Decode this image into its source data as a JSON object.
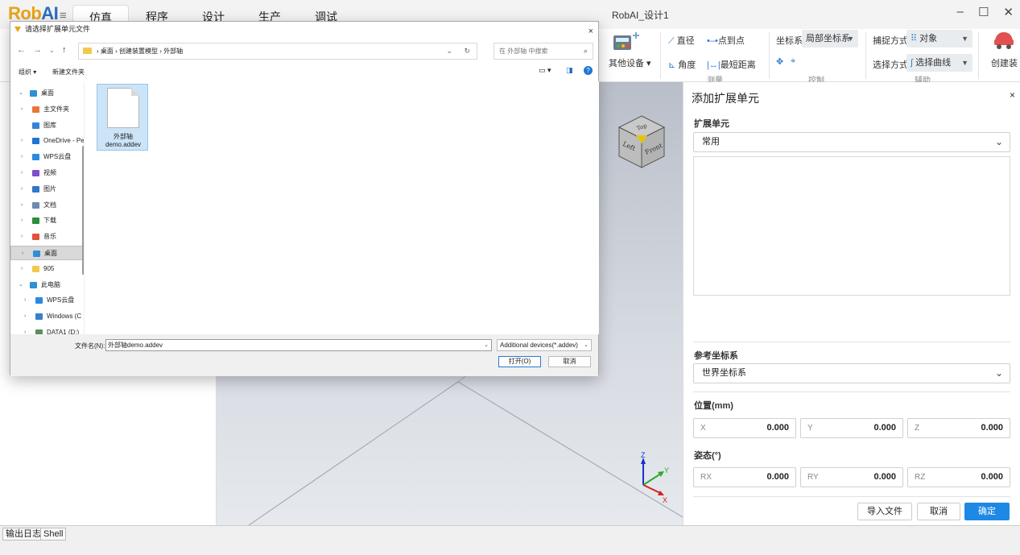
{
  "app": {
    "logo_rob": "Rob",
    "logo_ai": "AI",
    "window_title": "RobAI_设计1",
    "main_tabs": [
      "仿真",
      "程序",
      "设计",
      "生产",
      "调试"
    ]
  },
  "ribbon": {
    "other_devices": "其他设备",
    "diameter": "直径",
    "point_to_point": "点到点",
    "angle": "角度",
    "shortest_distance": "最短距离",
    "group_measure": "测量",
    "coord_label": "坐标系",
    "coord_value": "局部坐标系",
    "group_control": "控制",
    "snap_label": "捕捉方式",
    "snap_value": "对象",
    "select_label": "选择方式",
    "select_value": "选择曲线",
    "group_assist": "辅助",
    "create_label": "创建装"
  },
  "view_cube": {
    "top": "Top",
    "left": "Left",
    "front": "Front"
  },
  "axes": {
    "x": "X",
    "y": "Y",
    "z": "Z"
  },
  "panel": {
    "title": "添加扩展单元",
    "close": "×",
    "ext_unit_label": "扩展单元",
    "ext_unit_value": "常用",
    "ref_coord_label": "参考坐标系",
    "ref_coord_value": "世界坐标系",
    "position_label": "位置(mm)",
    "pose_label": "姿态(°)",
    "pos": [
      {
        "label": "X",
        "value": "0.000"
      },
      {
        "label": "Y",
        "value": "0.000"
      },
      {
        "label": "Z",
        "value": "0.000"
      }
    ],
    "rot": [
      {
        "label": "RX",
        "value": "0.000"
      },
      {
        "label": "RY",
        "value": "0.000"
      },
      {
        "label": "RZ",
        "value": "0.000"
      }
    ],
    "btn_import": "导入文件",
    "btn_cancel": "取消",
    "btn_ok": "确定"
  },
  "bottom_tabs": [
    "输出日志",
    "Shell"
  ],
  "dialog": {
    "title": "请选择扩展单元文件",
    "close": "×",
    "breadcrumb": "›  桌面  ›  创建装置模型  ›  外部轴",
    "search_placeholder": "在 外部轴 中搜索",
    "organize": "组织 ▾",
    "new_folder": "新建文件夹",
    "nav_items": [
      {
        "label": "桌面",
        "color": "#2f8fd8"
      },
      {
        "label": "主文件夹",
        "color": "#e8763a"
      },
      {
        "label": "图库",
        "color": "#3a82d6"
      },
      {
        "label": "OneDrive - Pe",
        "color": "#1e74d1"
      },
      {
        "label": "WPS云盘",
        "color": "#2a88e0"
      },
      {
        "label": "视频",
        "color": "#7b4fc9"
      },
      {
        "label": "图片",
        "color": "#2f77c8"
      },
      {
        "label": "文档",
        "color": "#6d8ab0"
      },
      {
        "label": "下载",
        "color": "#2c8c3c"
      },
      {
        "label": "音乐",
        "color": "#e0533b"
      },
      {
        "label": "桌面",
        "color": "#2f8fd8"
      },
      {
        "label": "905",
        "color": "#f2c94c"
      },
      {
        "label": "此电脑",
        "color": "#2f8fd8"
      },
      {
        "label": "WPS云盘",
        "color": "#2a88e0"
      },
      {
        "label": "Windows (C",
        "color": "#3a7fc8"
      },
      {
        "label": "DATA1 (D:)",
        "color": "#5a8f5a"
      }
    ],
    "file_name": "外部轴\ndemo.addev",
    "filename_label": "文件名(N):",
    "filename_value": "外部轴demo.addev",
    "filetype_value": "Additional devices(*.addev)",
    "open_btn": "打开(O)",
    "cancel_btn": "取消"
  }
}
